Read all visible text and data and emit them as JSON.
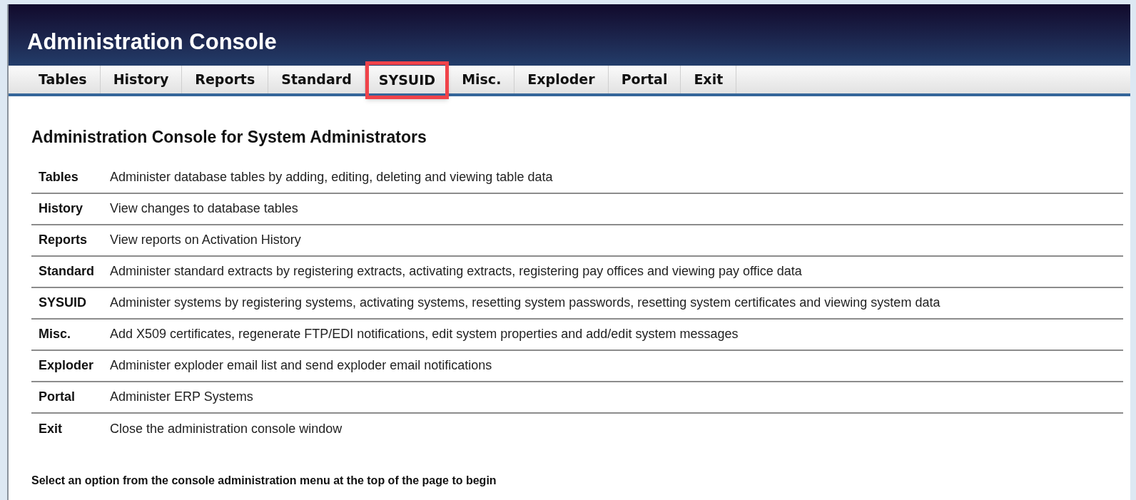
{
  "header": {
    "title": "Administration Console"
  },
  "tabs": [
    {
      "label": "Tables",
      "highlighted": false
    },
    {
      "label": "History",
      "highlighted": false
    },
    {
      "label": "Reports",
      "highlighted": false
    },
    {
      "label": "Standard",
      "highlighted": false
    },
    {
      "label": "SYSUID",
      "highlighted": true
    },
    {
      "label": "Misc.",
      "highlighted": false
    },
    {
      "label": "Exploder",
      "highlighted": false
    },
    {
      "label": "Portal",
      "highlighted": false
    },
    {
      "label": "Exit",
      "highlighted": false
    }
  ],
  "heading": "Administration Console for System Administrators",
  "options": [
    {
      "name": "Tables",
      "description": "Administer database tables by adding, editing, deleting and viewing table data"
    },
    {
      "name": "History",
      "description": "View changes to database tables"
    },
    {
      "name": "Reports",
      "description": "View reports on Activation History"
    },
    {
      "name": "Standard",
      "description": "Administer standard extracts by registering extracts, activating extracts, registering pay offices and viewing pay office data"
    },
    {
      "name": "SYSUID",
      "description": "Administer systems by registering systems, activating systems, resetting system passwords, resetting system certificates and viewing system data"
    },
    {
      "name": "Misc.",
      "description": "Add X509 certificates, regenerate FTP/EDI notifications, edit system properties and add/edit system messages"
    },
    {
      "name": "Exploder",
      "description": "Administer exploder email list and send exploder email notifications"
    },
    {
      "name": "Portal",
      "description": "Administer ERP Systems"
    },
    {
      "name": "Exit",
      "description": "Close the administration console window"
    }
  ],
  "footer": "Select an option from the console administration menu at the top of the page to begin"
}
